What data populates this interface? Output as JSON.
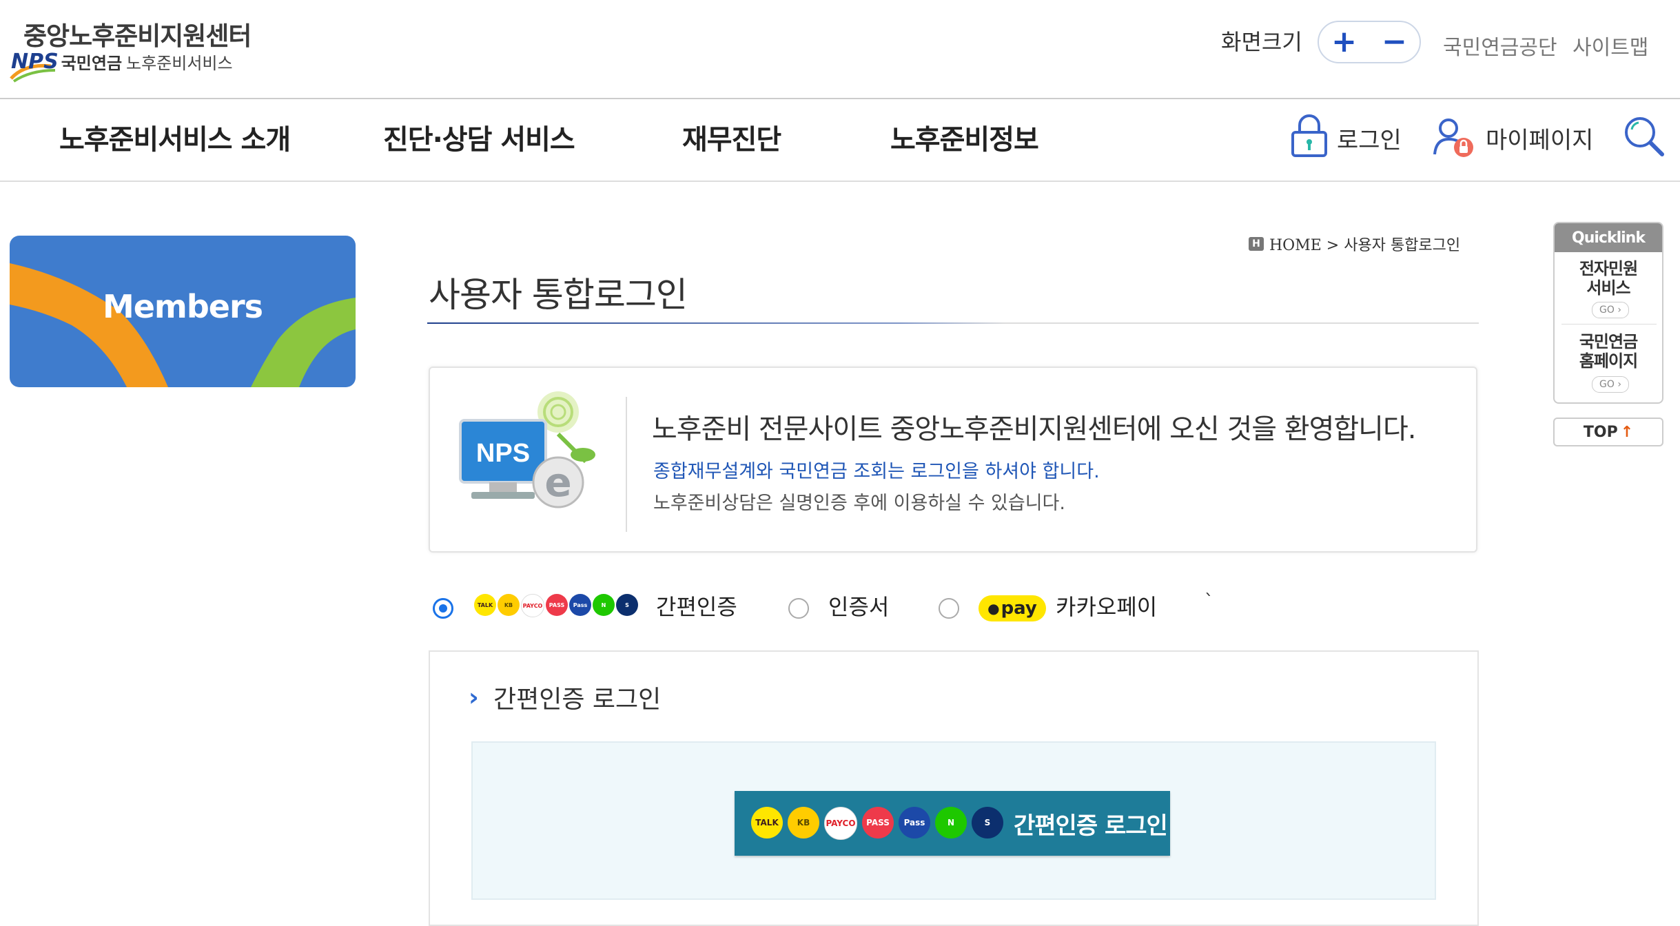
{
  "header": {
    "logo_main": "중앙노후준비지원센터",
    "logo_nps": "NPS",
    "logo_org": "국민연금",
    "logo_service": "노후준비서비스",
    "zoom_label": "화면크기",
    "zoom_in": "+",
    "zoom_out": "−",
    "links": {
      "nps": "국민연금공단",
      "sitemap": "사이트맵"
    }
  },
  "gnb": {
    "items": [
      "노후준비서비스 소개",
      "진단·상담 서비스",
      "재무진단",
      "노후준비정보"
    ],
    "login": "로그인",
    "mypage": "마이페이지"
  },
  "side": {
    "members_title": "Members"
  },
  "breadcrumb": {
    "home_icon": "H",
    "path": "HOME > 사용자 통합로그인"
  },
  "page": {
    "title": "사용자 통합로그인"
  },
  "welcome": {
    "graphic_text": "NPS",
    "title": "노후준비 전문사이트 중앙노후준비지원센터에 오신 것을 환영합니다.",
    "notice_blue": "종합재무설계와 국민연금 조회는 로그인을 하셔야 합니다.",
    "notice_gray": "노후준비상담은 실명인증 후에 이용하실 수 있습니다."
  },
  "login_options": {
    "selected": "easy",
    "easy_label": "간편인증",
    "cert_label": "인증서",
    "kakaopay_badge": "pay",
    "kakaopay_label": "카카오페이",
    "stray_mark": "`"
  },
  "easy_login": {
    "section_title": "간편인증 로그인",
    "button_label": "간편인증 로그인",
    "providers": [
      {
        "name": "kakao-talk",
        "text": "TALK",
        "bg": "#ffe600",
        "fg": "#3c1e1e"
      },
      {
        "name": "kb",
        "text": "KB",
        "bg": "#ffcc00",
        "fg": "#5a4a00"
      },
      {
        "name": "payco",
        "text": "PAYCO",
        "bg": "#ffffff",
        "fg": "#e0202a"
      },
      {
        "name": "pass",
        "text": "PASS",
        "bg": "#ee3a4a",
        "fg": "#ffffff"
      },
      {
        "name": "samsung-pass",
        "text": "Pass",
        "bg": "#1c49a8",
        "fg": "#ffffff"
      },
      {
        "name": "naver",
        "text": "N",
        "bg": "#1ec800",
        "fg": "#ffffff"
      },
      {
        "name": "shinhan",
        "text": "S",
        "bg": "#0c2f6e",
        "fg": "#ffffff"
      }
    ]
  },
  "quicklink": {
    "title": "Quicklink",
    "item1": "전자민원\n서비스",
    "item2": "국민연금\n홈페이지",
    "go": "GO ›",
    "top": "TOP",
    "top_arrow": "↑"
  },
  "colors": {
    "accent_blue": "#1f4fbf",
    "members_bg": "#3f7ccd",
    "button_teal": "#1e7c99",
    "kakao_yellow": "#ffe600"
  }
}
